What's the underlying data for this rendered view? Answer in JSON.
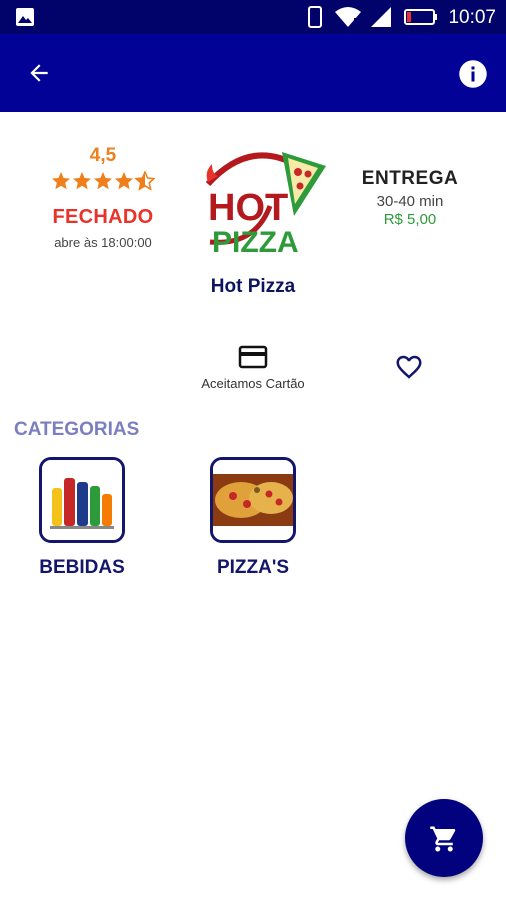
{
  "status_bar": {
    "time": "10:07",
    "battery_level": "7%"
  },
  "app_bar": {
    "back_icon": "arrow-left-icon",
    "info_icon": "info-icon",
    "color": "#020296"
  },
  "store": {
    "name": "Hot Pizza",
    "logo_text_top": "HOT",
    "logo_text_bottom": "PIZZA",
    "rating": "4,5",
    "stars": 4.5,
    "status": "FECHADO",
    "opens_at": "abre às 18:00:00"
  },
  "delivery": {
    "title": "ENTREGA",
    "time": "30-40 min",
    "fee": "R$ 5,00"
  },
  "payment": {
    "label": "Aceitamos Cartão",
    "icon": "credit-card-icon"
  },
  "favorite": {
    "icon": "heart-outline-icon"
  },
  "categories": {
    "title": "CATEGORIAS",
    "items": [
      {
        "label": "BEBIDAS",
        "image": "drinks"
      },
      {
        "label": "PIZZA'S",
        "image": "pizza"
      }
    ]
  },
  "cart_fab": {
    "icon": "cart-icon",
    "color": "#02027e"
  }
}
